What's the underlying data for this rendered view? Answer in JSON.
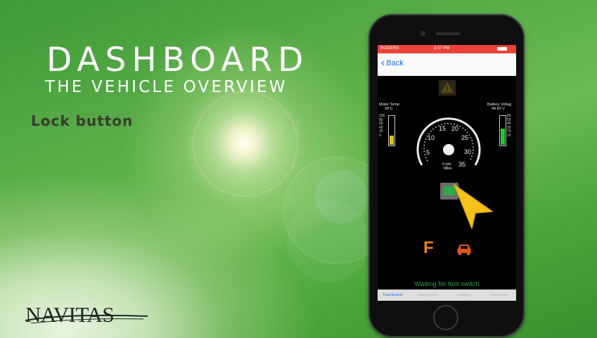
{
  "slide": {
    "title": "DASHBOARD",
    "subtitle": "THE VEHICLE OVERVIEW",
    "caption": "Lock button",
    "logo_text": "NAVITAS"
  },
  "phone": {
    "status_bar": {
      "carrier": "ROGERS",
      "time": "3:57 PM"
    },
    "nav": {
      "back_label": "Back"
    },
    "motor_temp": {
      "label": "Motor Temp",
      "value": "28 C",
      "ticks": [
        "100",
        "80",
        "60",
        "40",
        "20",
        "0"
      ],
      "level": 0.3
    },
    "battery": {
      "label": "Battery Voltag",
      "value": "49.82 V",
      "ticks": [
        "60",
        "50",
        "40",
        "30",
        "20",
        "10"
      ],
      "level": 0.55
    },
    "speedometer": {
      "ticks": [
        "5",
        "10",
        "15",
        "20",
        "25",
        "30",
        "35"
      ],
      "rpm": "0 rpm",
      "unit": "Miles"
    },
    "gear": "F",
    "status_message": "Waiting for foot switch",
    "tabs": [
      "Dashboard",
      "Diagnostics",
      "Settings",
      "Download"
    ],
    "active_tab": "Dashboard"
  },
  "colors": {
    "background_green": "#4da63c",
    "status_bar_red": "#e8423a",
    "gear_orange": "#f07f22",
    "status_green": "#2e9d45",
    "cursor_yellow": "#f4c21a",
    "tab_active_blue": "#2d7ad8"
  }
}
